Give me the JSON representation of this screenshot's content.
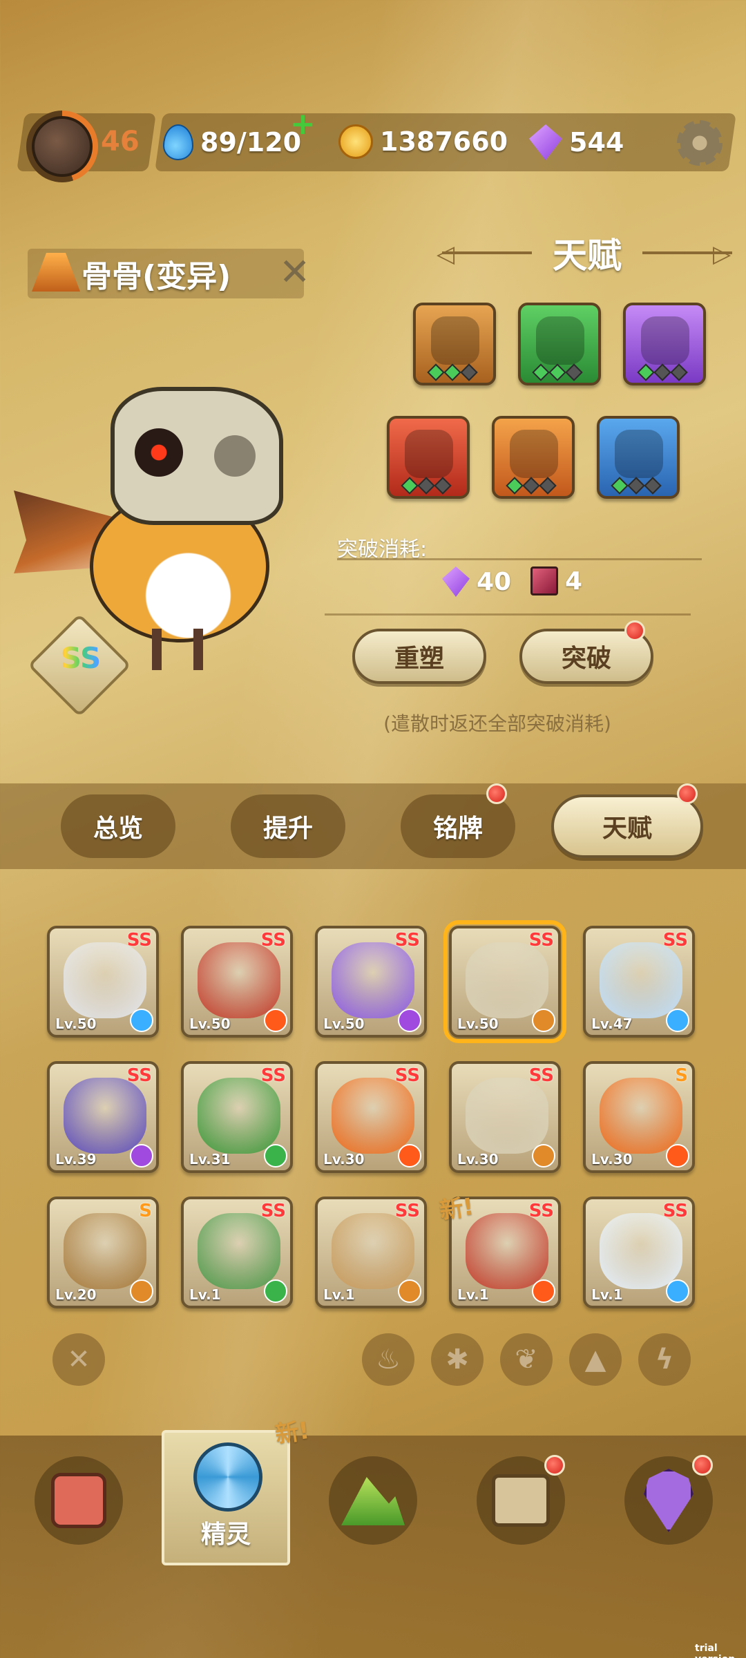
{
  "top": {
    "player_level": "46",
    "energy": "89/120",
    "coins": "1387660",
    "gems": "544"
  },
  "spirit": {
    "name": "骨骨(变异)",
    "rank": "SS"
  },
  "talent": {
    "title": "天赋",
    "icons": [
      {
        "name": "talent-orange",
        "pips": 2
      },
      {
        "name": "talent-green",
        "pips": 2
      },
      {
        "name": "talent-purple",
        "pips": 1
      },
      {
        "name": "talent-red",
        "pips": 1
      },
      {
        "name": "talent-amber",
        "pips": 1
      },
      {
        "name": "talent-blue",
        "pips": 1
      }
    ],
    "break_label": "突破消耗:",
    "cost_gems": "40",
    "cost_books": "4",
    "reshape_label": "重塑",
    "break_button_label": "突破",
    "note": "(遣散时返还全部突破消耗)"
  },
  "tabs": {
    "overview": "总览",
    "upgrade": "提升",
    "plate": "铭牌",
    "talent": "天赋"
  },
  "spirits": [
    {
      "lv": "Lv.50",
      "rank": "SS",
      "element": "ice",
      "color": "#e5e8ef"
    },
    {
      "lv": "Lv.50",
      "rank": "SS",
      "element": "fire",
      "color": "#c43a2a"
    },
    {
      "lv": "Lv.50",
      "rank": "SS",
      "element": "thunder",
      "color": "#8a5ae8"
    },
    {
      "lv": "Lv.50",
      "rank": "SS",
      "element": "earth",
      "color": "#d8cfb4"
    },
    {
      "lv": "Lv.47",
      "rank": "SS",
      "element": "ice",
      "color": "#bfe0ff"
    },
    {
      "lv": "Lv.39",
      "rank": "SS",
      "element": "thunder",
      "color": "#5a4ac0"
    },
    {
      "lv": "Lv.31",
      "rank": "SS",
      "element": "leaf",
      "color": "#3a9a3a"
    },
    {
      "lv": "Lv.30",
      "rank": "SS",
      "element": "fire",
      "color": "#f06a1a"
    },
    {
      "lv": "Lv.30",
      "rank": "SS",
      "element": "earth",
      "color": "#d8cfb4"
    },
    {
      "lv": "Lv.30",
      "rank": "S",
      "element": "fire",
      "color": "#f06a1a"
    },
    {
      "lv": "Lv.20",
      "rank": "S",
      "element": "earth",
      "color": "#a87a3a"
    },
    {
      "lv": "Lv.1",
      "rank": "SS",
      "element": "leaf",
      "color": "#4a9a4a"
    },
    {
      "lv": "Lv.1",
      "rank": "SS",
      "element": "earth",
      "color": "#c89a5a"
    },
    {
      "lv": "Lv.1",
      "rank": "SS",
      "element": "fire",
      "color": "#c43a2a"
    },
    {
      "lv": "Lv.1",
      "rank": "SS",
      "element": "ice",
      "color": "#e6f2ff"
    }
  ],
  "new_tag": "新!",
  "nav": {
    "spirit_label": "精灵"
  },
  "watermark": "trial version"
}
